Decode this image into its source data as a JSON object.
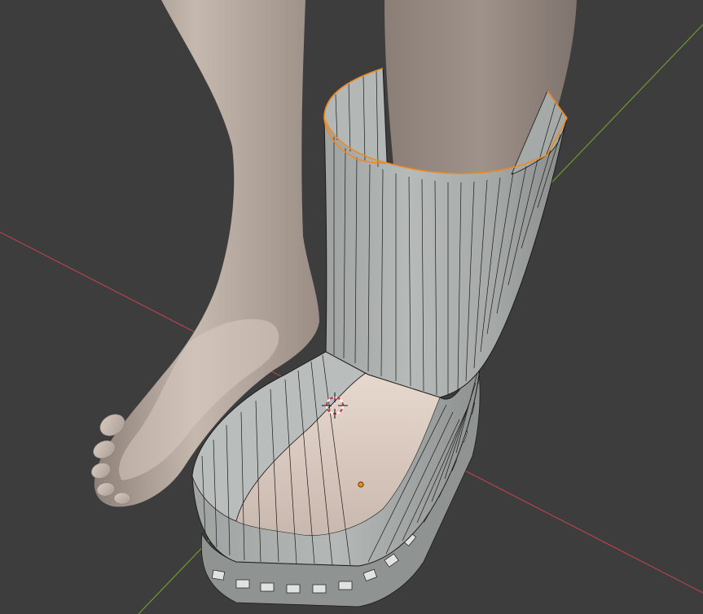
{
  "viewport": {
    "background": "#3d3d3d",
    "colors": {
      "axis_x": "#b3434d",
      "axis_y": "#6e9a2e",
      "skin": "#c9bdb2",
      "skin_dark": "#9b8e85",
      "skin_light": "#e3d6cc",
      "mesh_face": "#a6aaa8",
      "mesh_face_light": "#c3c7c5",
      "wire": "#1b1b1b",
      "selection": "#f08a1c",
      "origin_dot": "#f08a1c",
      "cursor_red": "#d1323c",
      "cursor_white": "#ffffff"
    },
    "icons": {
      "cursor": "3d-cursor-icon",
      "origin": "object-origin-icon"
    }
  }
}
